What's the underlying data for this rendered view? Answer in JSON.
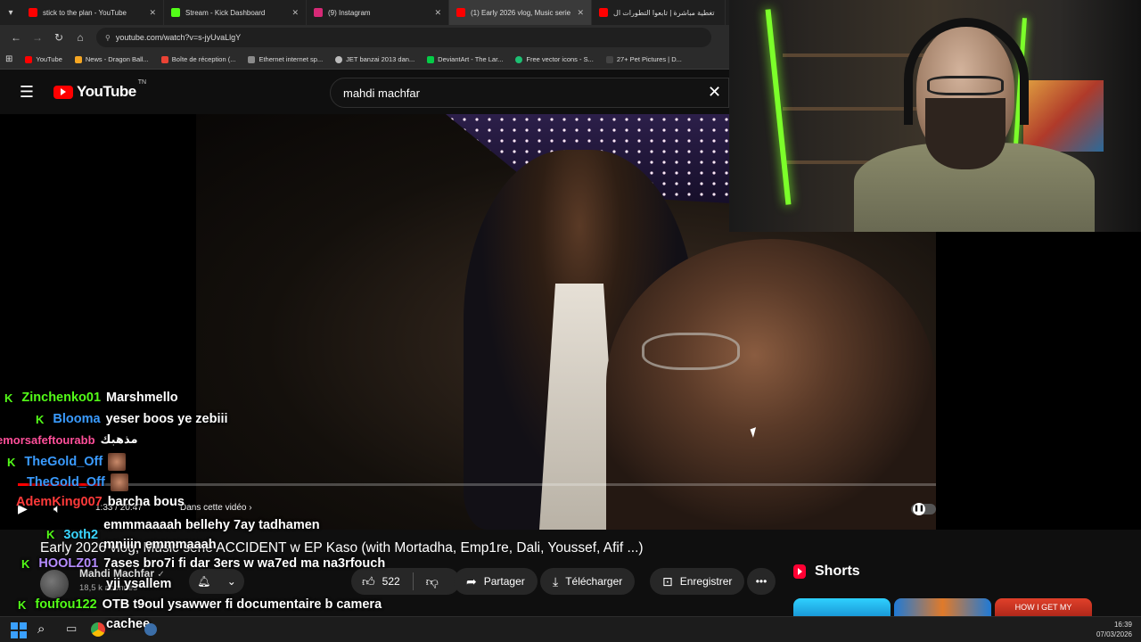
{
  "browser": {
    "tabs": [
      {
        "title": "stick to the plan - YouTube",
        "icon": "youtube-favicon",
        "color": "#ff0000"
      },
      {
        "title": "Stream - Kick Dashboard",
        "icon": "kick-favicon",
        "color": "#53fc18"
      },
      {
        "title": "(9) Instagram",
        "icon": "instagram-favicon",
        "color": "#d62976"
      },
      {
        "title": "(1) Early 2026 vlog, Music serie",
        "icon": "youtube-favicon",
        "color": "#ff0000",
        "active": true
      },
      {
        "title": "تغطية مباشرة | تابعوا التطورات ال",
        "icon": "youtube-favicon",
        "color": "#ff0000"
      }
    ],
    "url": "youtube.com/watch?v=s-jyUvaLlgY",
    "bookmarks": [
      {
        "label": "YouTube",
        "color": "#ff0000"
      },
      {
        "label": "News - Dragon Ball...",
        "color": "#f5a623"
      },
      {
        "label": "Boîte de réception (...",
        "color": "#ea4335"
      },
      {
        "label": "Ethernet internet sp...",
        "color": "#8a8a8a"
      },
      {
        "label": "JET banzai 2013 dan...",
        "color": "#bbbbbb"
      },
      {
        "label": "DeviantArt - The Lar...",
        "color": "#05cc47"
      },
      {
        "label": "Free vector icons - S...",
        "color": "#1dbf73"
      },
      {
        "label": "27+ Pet Pictures | D...",
        "color": "#444444"
      }
    ]
  },
  "youtube": {
    "logo_text": "YouTube",
    "region": "TN",
    "search_query": "mahdi machfar",
    "player": {
      "time": "1:33 / 20:47",
      "chapter": "Dans cette vidéo",
      "progress": 0.075
    },
    "video_title": "Early 2026 vlog, Music serie ACCIDENT w EP Kaso (with Mortadha, Emp1re, Dali, Youssef, Afif ...)",
    "channel_name": "Mahdi Machfar",
    "subscribers": "18,5 k abonnés",
    "likes": "522",
    "share": "Partager",
    "download": "Télécharger",
    "save": "Enregistrer",
    "shorts_title": "Shorts",
    "short_thumb_text": "HOW I GET MY"
  },
  "chat": [
    {
      "user": "Zinchenko01",
      "user_color": "#53fc18",
      "message": "Marshmello",
      "badge": true
    },
    {
      "user": "Blooma",
      "user_color": "#3a9bff",
      "message": "yeser boos ye zebiii",
      "badge": true
    },
    {
      "user": "emorsafeftourabb",
      "user_color": "#ff4f9a",
      "message": "مذهبك",
      "badge": false
    },
    {
      "user": "TheGold_Off",
      "user_color": "#3a9bff",
      "message": "",
      "badge": true,
      "emote": true
    },
    {
      "user": "TheGold_Off",
      "user_color": "#3a9bff",
      "message": "",
      "badge": false,
      "emote": true
    },
    {
      "user": "AdemKing007",
      "user_color": "#ff3a3a",
      "message": "barcha bous",
      "badge": false
    },
    {
      "user": "3oth2",
      "user_color": "#3ad6ff",
      "message": "emmmaaaah bellehy 7ay tadhamen mniiin emmmaaah",
      "badge": true
    },
    {
      "user": "HOOLZ01",
      "user_color": "#b58cff",
      "message": "7ases bro7i fi dar 3ers w wa7ed ma na3rfouch",
      "badge": true
    },
    {
      "user": "",
      "user_color": "#ffffff",
      "message": "yji ysallem",
      "badge": false
    },
    {
      "user": "foufou122",
      "user_color": "#53fc18",
      "message": "OTB t9oul ysawwer fi documentaire b camera",
      "badge": true
    },
    {
      "user": "",
      "user_color": "#ffffff",
      "message": "cachee",
      "badge": false
    }
  ],
  "taskbar": {
    "time": "16:39",
    "date": "07/03/2026"
  }
}
